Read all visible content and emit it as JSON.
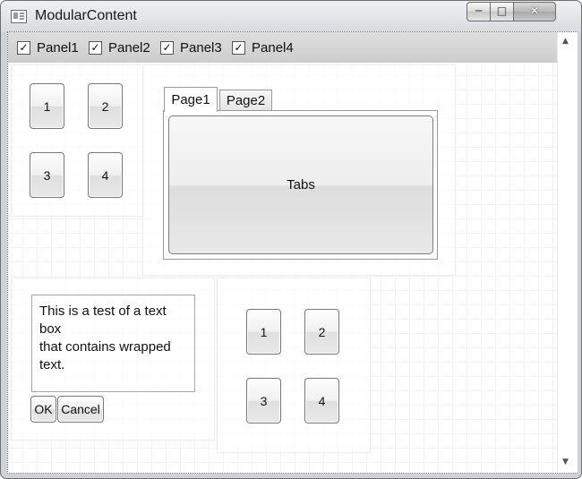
{
  "window": {
    "title": "ModularContent",
    "minimize_glyph": "─",
    "maximize_glyph": "□",
    "close_glyph": "✕"
  },
  "toolbar": {
    "checkboxes": [
      {
        "label": "Panel1",
        "checked": true,
        "mark": "✓"
      },
      {
        "label": "Panel2",
        "checked": true,
        "mark": "✓"
      },
      {
        "label": "Panel3",
        "checked": true,
        "mark": "✓"
      },
      {
        "label": "Panel4",
        "checked": true,
        "mark": "✓"
      }
    ]
  },
  "panel1": {
    "buttons": [
      "1",
      "2",
      "3",
      "4"
    ]
  },
  "panel2": {
    "tabs": [
      "Page1",
      "Page2"
    ],
    "selected_tab": "Page1",
    "content_button": "Tabs"
  },
  "panel3": {
    "textbox_value": "This is a test of a text box\nthat contains wrapped\ntext.",
    "ok_label": "OK",
    "cancel_label": "Cancel"
  },
  "panel4": {
    "buttons": [
      "1",
      "2",
      "3",
      "4"
    ]
  },
  "scrollbar": {
    "up_glyph": "▲",
    "down_glyph": "▼"
  }
}
